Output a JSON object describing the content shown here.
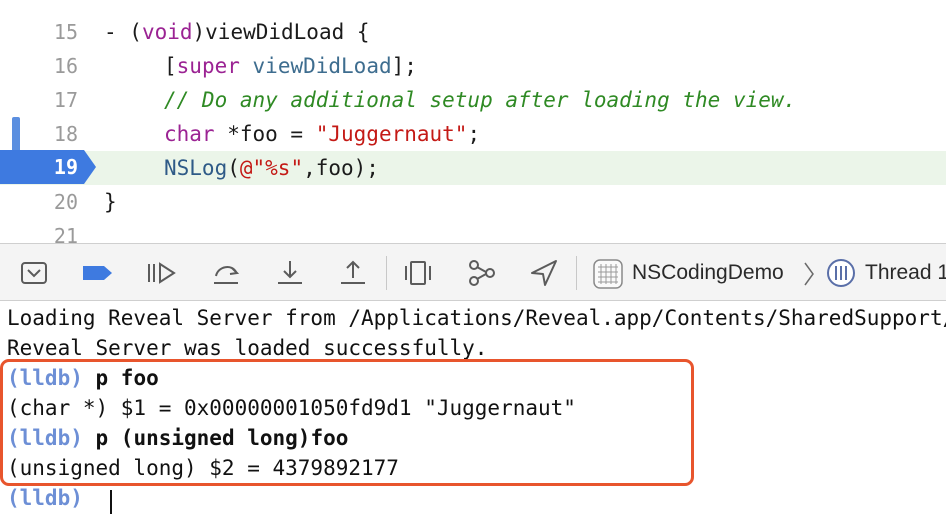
{
  "editor": {
    "lines": [
      {
        "num": "15",
        "parts": [
          {
            "t": "- (",
            "c": ""
          },
          {
            "t": "void",
            "c": "kw"
          },
          {
            "t": ")viewDidLoad {",
            "c": ""
          }
        ]
      },
      {
        "num": "16",
        "parts": [
          {
            "t": "[",
            "c": ""
          },
          {
            "t": "super",
            "c": "kw"
          },
          {
            "t": " ",
            "c": ""
          },
          {
            "t": "viewDidLoad",
            "c": "fn"
          },
          {
            "t": "];",
            "c": ""
          }
        ]
      },
      {
        "num": "17",
        "parts": [
          {
            "t": "// Do any additional setup after loading the view.",
            "c": "cm"
          }
        ]
      },
      {
        "num": "18",
        "parts": [
          {
            "t": "char",
            "c": "kw"
          },
          {
            "t": " *foo = ",
            "c": ""
          },
          {
            "t": "\"Juggernaut\"",
            "c": "str"
          },
          {
            "t": ";",
            "c": ""
          }
        ]
      },
      {
        "num": "19",
        "parts": [
          {
            "t": "NSLog",
            "c": "cls"
          },
          {
            "t": "(",
            "c": ""
          },
          {
            "t": "@\"%s\"",
            "c": "str"
          },
          {
            "t": ",foo);",
            "c": ""
          }
        ]
      },
      {
        "num": "20",
        "parts": [
          {
            "t": "}",
            "c": ""
          }
        ]
      },
      {
        "num": "21",
        "parts": []
      }
    ],
    "current_line": "19",
    "colors": {
      "keyword": "#9b2393",
      "comment": "#2f8a24",
      "string": "#c41a16",
      "breakpoint": "#3e7ae0",
      "current_line_bg": "#ebf5e9"
    }
  },
  "toolbar": {
    "buttons": [
      {
        "name": "hide-debug-area-button",
        "icon": "hide-debug-area-icon"
      },
      {
        "name": "breakpoints-toggle-button",
        "icon": "breakpoint-tag-icon"
      },
      {
        "name": "continue-button",
        "icon": "continue-icon"
      },
      {
        "name": "step-over-button",
        "icon": "step-over-icon"
      },
      {
        "name": "step-into-button",
        "icon": "step-into-icon"
      },
      {
        "name": "step-out-button",
        "icon": "step-out-icon"
      },
      {
        "name": "debug-view-hierarchy-button",
        "icon": "view-hierarchy-icon"
      },
      {
        "name": "debug-memory-graph-button",
        "icon": "memory-graph-icon"
      },
      {
        "name": "simulate-location-button",
        "icon": "location-arrow-icon"
      }
    ],
    "breadcrumb": {
      "app": "NSCodingDemo",
      "thread": "Thread 1"
    }
  },
  "console": {
    "log1": "Loading Reveal Server from /Applications/Reveal.app/Contents/SharedSupport/iOS-Libraries/RevealServer.framework...",
    "log2": "Reveal Server was loaded successfully.",
    "prompt": "(lldb)",
    "cmd1": "p foo",
    "out1": "(char *) $1 = 0x00000001050fd9d1 \"Juggernaut\"",
    "cmd2": "p (unsigned long)foo",
    "out2": "(unsigned long) $2 = 4379892177",
    "highlight_color": "#e8552d"
  }
}
